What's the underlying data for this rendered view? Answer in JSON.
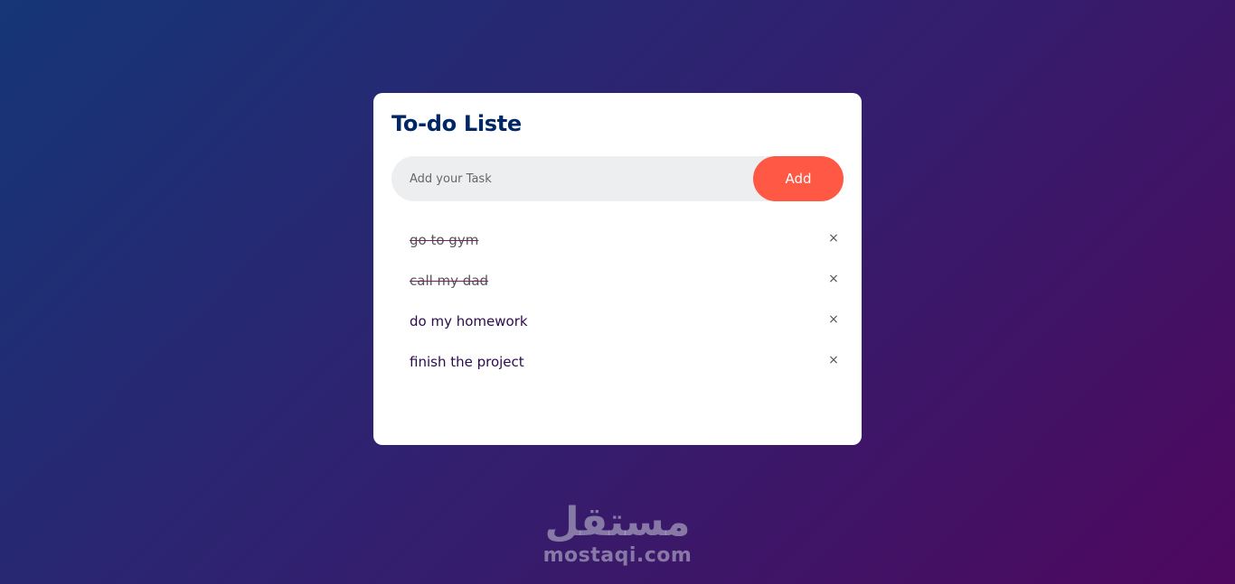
{
  "app": {
    "title": "To-do Liste"
  },
  "input": {
    "placeholder": "Add your Task",
    "value": ""
  },
  "add_button": {
    "label": "Add"
  },
  "tasks": [
    {
      "text": "go to gym",
      "checked": true
    },
    {
      "text": "call my dad",
      "checked": true
    },
    {
      "text": "do my homework",
      "checked": false
    },
    {
      "text": "finish the project",
      "checked": false
    }
  ],
  "delete_glyph": "×",
  "watermark": {
    "arabic": "مستقل",
    "domain": "mostaqi.com"
  },
  "colors": {
    "title": "#002765",
    "accent": "#ff5945",
    "input_bg": "#edeef0",
    "gradient_start": "#153677",
    "gradient_end": "#4e085f"
  }
}
